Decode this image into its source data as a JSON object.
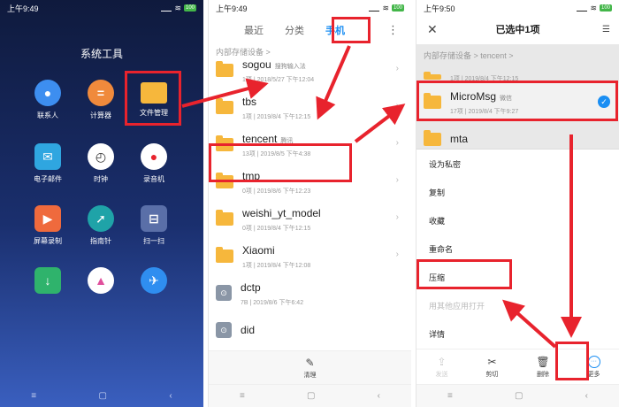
{
  "phone1": {
    "status": {
      "time": "上午9:49",
      "battery": "100"
    },
    "title": "系统工具",
    "apps": [
      {
        "label": "联系人",
        "icon": "person-icon",
        "color": "#3d8ef0"
      },
      {
        "label": "计算器",
        "icon": "calculator-icon",
        "color": "#f08a3c"
      },
      {
        "label": "文件管理",
        "icon": "folder-icon",
        "color": "#f6b73c"
      },
      {
        "label": "电子邮件",
        "icon": "mail-icon",
        "color": "#2fa6e0"
      },
      {
        "label": "时钟",
        "icon": "clock-icon",
        "color": "#ffffff"
      },
      {
        "label": "录音机",
        "icon": "recorder-icon",
        "color": "#ffffff"
      },
      {
        "label": "屏幕录制",
        "icon": "screen-record-icon",
        "color": "#ef6a3d"
      },
      {
        "label": "指南针",
        "icon": "compass-icon",
        "color": "#1fa3a8"
      },
      {
        "label": "扫一扫",
        "icon": "scan-icon",
        "color": "#5a6fa8"
      },
      {
        "label": "",
        "icon": "download-icon",
        "color": "#2fb36c"
      },
      {
        "label": "",
        "icon": "app-store-icon",
        "color": "#ffffff"
      },
      {
        "label": "",
        "icon": "plane-icon",
        "color": "#2f8ef0"
      }
    ]
  },
  "phone2": {
    "status": {
      "time": "上午9:49",
      "battery": "100"
    },
    "tabs": [
      "最近",
      "分类",
      "手机"
    ],
    "breadcrumb": "内部存储设备 >",
    "files": [
      {
        "name": "sogou",
        "tag": "搜狗输入法",
        "meta": "1项 | 2018/5/27 下午12:04",
        "type": "folder"
      },
      {
        "name": "tbs",
        "tag": "",
        "meta": "1项 | 2019/8/4 下午12:15",
        "type": "folder"
      },
      {
        "name": "tencent",
        "tag": "腾讯",
        "meta": "13项 | 2019/8/5 下午4:38",
        "type": "folder"
      },
      {
        "name": "tmp",
        "tag": "",
        "meta": "0项 | 2019/8/6 下午12:23",
        "type": "folder"
      },
      {
        "name": "weishi_yt_model",
        "tag": "",
        "meta": "0项 | 2019/8/4 下午12:15",
        "type": "folder"
      },
      {
        "name": "Xiaomi",
        "tag": "",
        "meta": "1项 | 2019/8/4 下午12:08",
        "type": "folder"
      },
      {
        "name": "dctp",
        "tag": "",
        "meta": "7B | 2019/8/6 下午6:42",
        "type": "file"
      },
      {
        "name": "did",
        "tag": "",
        "meta": "",
        "type": "file"
      }
    ],
    "toolbar": {
      "clean_label": "清理"
    }
  },
  "phone3": {
    "status": {
      "time": "上午9:50",
      "battery": "100"
    },
    "header": "已选中1项",
    "breadcrumb": "内部存储设备 > tencent >",
    "rows": [
      {
        "name": "",
        "meta": "1项 | 2019/8/4 下午12:15",
        "tag": ""
      },
      {
        "name": "MicroMsg",
        "tag": "微信",
        "meta": "17项 | 2019/8/4 下午9:27"
      },
      {
        "name": "mta",
        "tag": "",
        "meta": ""
      }
    ],
    "menu": [
      "设为私密",
      "复制",
      "收藏",
      "重命名",
      "压缩",
      "用其他应用打开",
      "详情"
    ],
    "toolbar": [
      "发送",
      "剪切",
      "删除",
      "更多"
    ]
  },
  "navbar": [
    "≡",
    "▢",
    "‹"
  ],
  "colors": {
    "highlight": "#e8232d",
    "accent": "#1a8ef3"
  }
}
